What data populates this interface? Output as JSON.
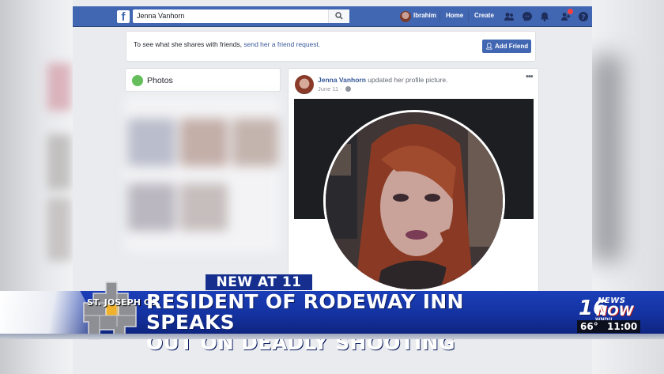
{
  "facebook": {
    "search": {
      "value": "Jenna Vanhorn"
    },
    "nav": {
      "user": "Ibrahim",
      "home": "Home",
      "create": "Create"
    },
    "friend_prompt": {
      "text": "To see what she shares with friends, ",
      "link": "send her a friend request.",
      "button": "Add Friend"
    },
    "photos": {
      "title": "Photos"
    },
    "post": {
      "author": "Jenna Vanhorn",
      "action": " updated her profile picture.",
      "date": "June 11 · ",
      "more": "•••"
    }
  },
  "broadcast": {
    "tag": "NEW AT 11",
    "county": "ST. JOSEPH CO.",
    "headline_line1": "RESIDENT OF RODEWAY INN SPEAKS",
    "headline_line2": "OUT ON DEADLY SHOOTING",
    "station": {
      "number": "16",
      "news": "NEWS",
      "now": "NOW",
      "call": "WNDU",
      "temperature": "66°",
      "time": "11:00"
    }
  },
  "colors": {
    "facebook_blue": "#4267b2",
    "lower_third_blue": "#1432a0",
    "link_blue": "#385898"
  }
}
